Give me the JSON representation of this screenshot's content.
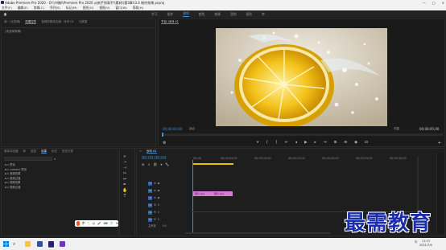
{
  "window": {
    "title": "Adobe Premiere Pro 2020 - D:\\\\书稿\\\\Premiere Pro 2020 从新手到高手\\\\素材\\\\第3章\\\\3.4 制作效果.prproj",
    "min": "—",
    "max": "□",
    "close": "✕"
  },
  "menu": [
    "文件(F)",
    "编辑(E)",
    "剪辑(C)",
    "序列(S)",
    "标记(M)",
    "图形(G)",
    "视图(V)",
    "窗口(W)",
    "帮助(H)"
  ],
  "workspaces": {
    "items": [
      "学习",
      "组件",
      "编辑",
      "颜色",
      "效果",
      "音频",
      "图形",
      "库"
    ],
    "active": "编辑"
  },
  "source_panel": {
    "tabs": [
      "源：(无剪辑)",
      "效果控件",
      "音频剪辑混合器：序列 01",
      "元数据"
    ],
    "active_tab": "效果控件",
    "sub_label": "(未选择剪辑)"
  },
  "program_monitor": {
    "tab": "节目: 序列 01",
    "timecode_left": "00;00;00;00",
    "fit": "适合",
    "quality": "完整",
    "timecode_right": "00;00;05;00"
  },
  "project_panel": {
    "tabs": [
      "媒体浏览器",
      "库",
      "信息",
      "效果",
      "标记",
      "历史记录"
    ],
    "active_tab": "效果",
    "tree": [
      "预设",
      "Lumetri 预设",
      "音频效果",
      "音频过渡",
      "视频效果",
      "视频过渡"
    ]
  },
  "timeline": {
    "tab": "序列 01",
    "timecode": "00;00;00;00",
    "ruler": [
      "00;00",
      "00;00;05;00",
      "00;00;10;00",
      "00;00;15;00",
      "00;00;20;00",
      "00;00;25;00",
      "00;00;30;00"
    ],
    "video_tracks": [
      "V3",
      "V2",
      "V1"
    ],
    "audio_tracks": [
      "A1",
      "A2",
      "A3"
    ],
    "master": "主声道",
    "master_value": "0.0",
    "clip_a": "图片.jpg",
    "clip_b": "图片.jpg"
  },
  "ime": {
    "label": "中",
    "items": [
      "中",
      "°,",
      "☺",
      "🎤",
      "⌨",
      "👕",
      "⊞"
    ]
  },
  "taskbar": {
    "time": "11:13",
    "date": "2021/7/6",
    "lang": "中"
  },
  "watermark": "最需教育",
  "colors": {
    "accent": "#3b8fd8",
    "clip": "#d67ad6",
    "watermark": "#1b2ea8"
  }
}
